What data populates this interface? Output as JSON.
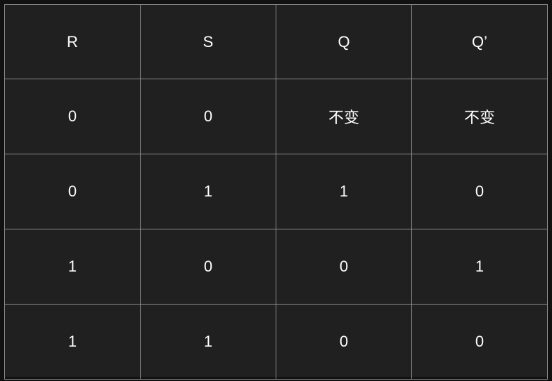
{
  "table": {
    "headers": [
      "R",
      "S",
      "Q",
      "Q’"
    ],
    "rows": [
      [
        "0",
        "0",
        "不变",
        "不变"
      ],
      [
        "0",
        "1",
        "1",
        "0"
      ],
      [
        "1",
        "0",
        "0",
        "1"
      ],
      [
        "1",
        "1",
        "0",
        "0"
      ]
    ]
  },
  "colors": {
    "background": "#202020",
    "grid": "#8c8c8c",
    "text": "#ffffff"
  }
}
